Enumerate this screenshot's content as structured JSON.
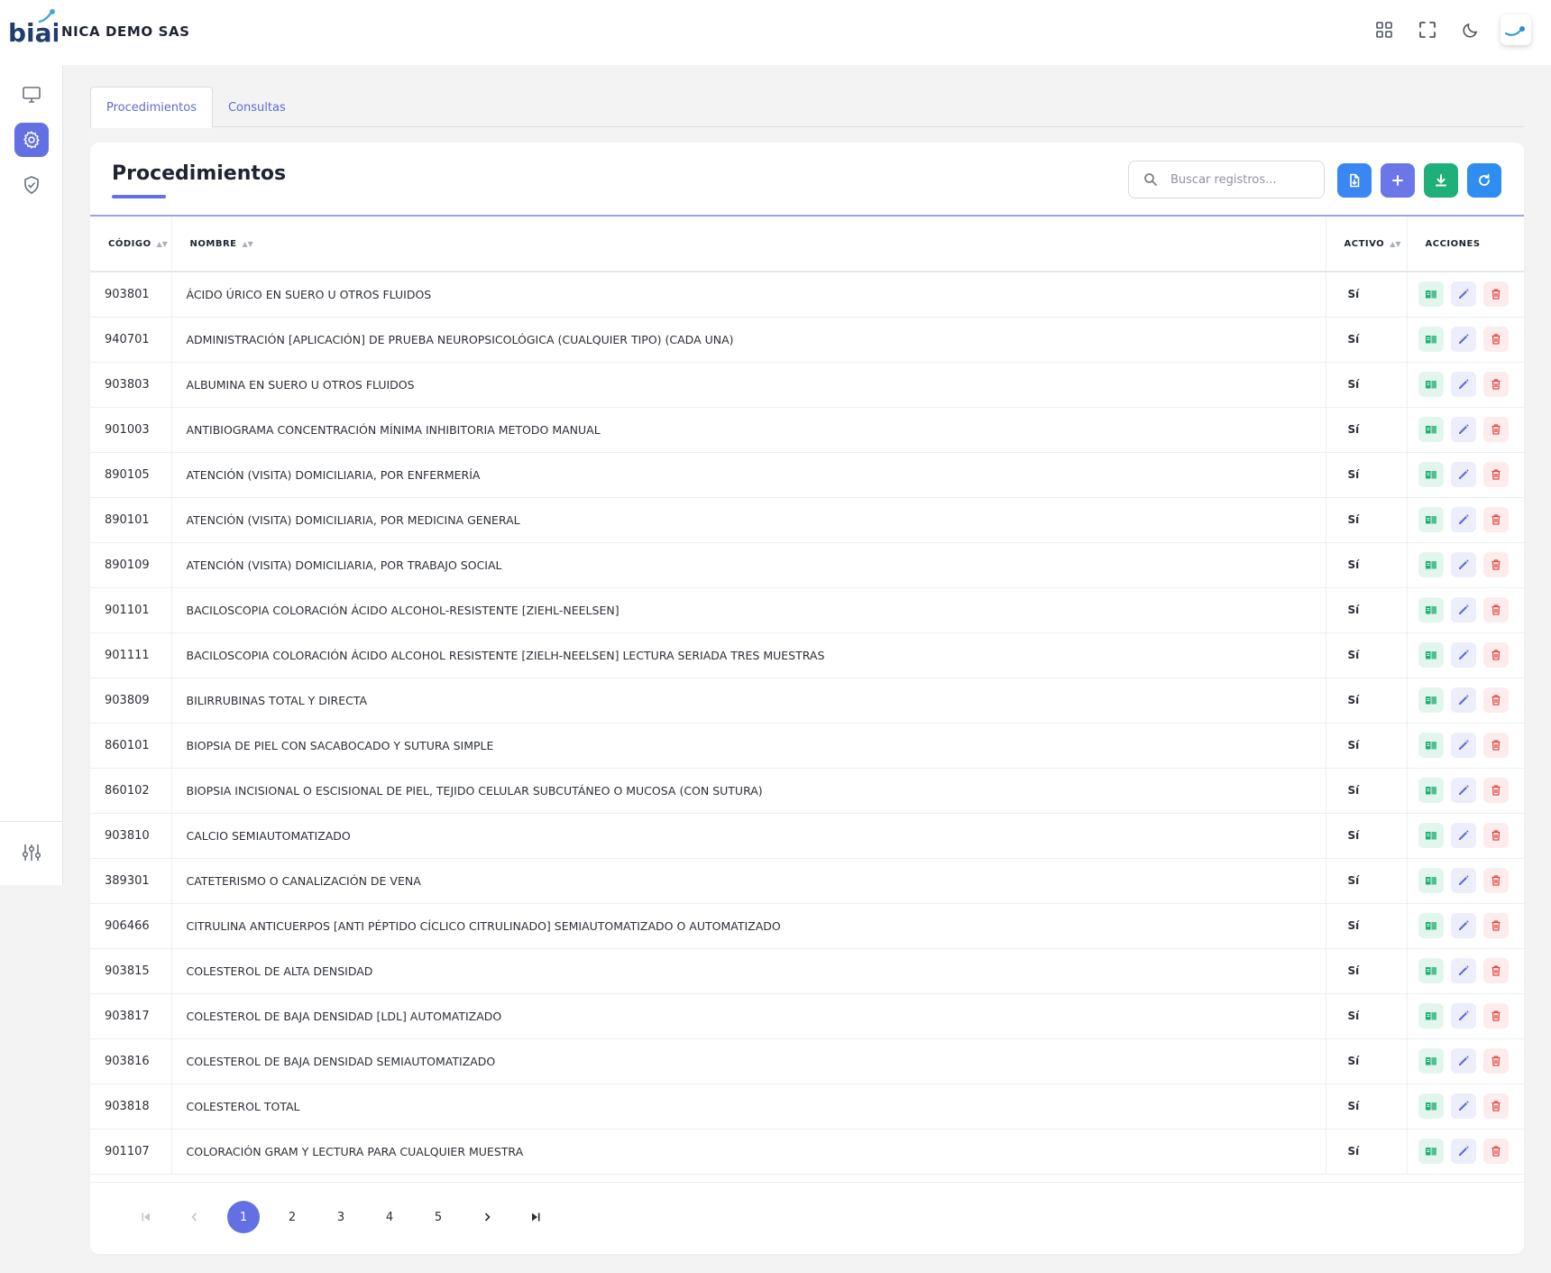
{
  "app": {
    "logo_text": "biai",
    "company": "NICA DEMO SAS"
  },
  "header": {
    "icons": [
      "apps-grid-icon",
      "fullscreen-icon",
      "moon-icon",
      "user-avatar-logo"
    ]
  },
  "sidebar": {
    "items": [
      "monitor-icon",
      "settings-gear-icon",
      "shield-check-icon"
    ],
    "bottom_item": "sliders-icon",
    "active_index": 1
  },
  "tabs": [
    {
      "label": "Procedimientos",
      "active": true
    },
    {
      "label": "Consultas",
      "active": false
    }
  ],
  "card": {
    "title": "Procedimientos",
    "search_placeholder": "Buscar registros...",
    "actions": [
      "import-file-icon",
      "add-icon",
      "download-icon",
      "refresh-icon"
    ]
  },
  "table": {
    "columns": [
      "CÓDIGO",
      "NOMBRE",
      "ACTIVO",
      "ACCIONES"
    ],
    "rows": [
      {
        "code": "903801",
        "name": "ÁCIDO ÚRICO EN SUERO U OTROS FLUIDOS",
        "active": "Sí"
      },
      {
        "code": "940701",
        "name": "ADMINISTRACIÓN [APLICACIÓN] DE PRUEBA NEUROPSICOLÓGICA (CUALQUIER TIPO) (CADA UNA)",
        "active": "Sí"
      },
      {
        "code": "903803",
        "name": "ALBUMINA EN SUERO U OTROS FLUIDOS",
        "active": "Sí"
      },
      {
        "code": "901003",
        "name": "ANTIBIOGRAMA CONCENTRACIÓN MÍNIMA INHIBITORIA METODO MANUAL",
        "active": "Sí"
      },
      {
        "code": "890105",
        "name": "ATENCIÓN (VISITA) DOMICILIARIA, POR ENFERMERÍA",
        "active": "Sí"
      },
      {
        "code": "890101",
        "name": "ATENCIÓN (VISITA) DOMICILIARIA, POR MEDICINA GENERAL",
        "active": "Sí"
      },
      {
        "code": "890109",
        "name": "ATENCIÓN (VISITA) DOMICILIARIA, POR TRABAJO SOCIAL",
        "active": "Sí"
      },
      {
        "code": "901101",
        "name": "BACILOSCOPIA COLORACIÓN ÁCIDO ALCOHOL-RESISTENTE [ZIEHL-NEELSEN]",
        "active": "Sí"
      },
      {
        "code": "901111",
        "name": "BACILOSCOPIA COLORACIÓN ÁCIDO ALCOHOL RESISTENTE [ZIELH-NEELSEN] LECTURA SERIADA TRES MUESTRAS",
        "active": "Sí"
      },
      {
        "code": "903809",
        "name": "BILIRRUBINAS TOTAL Y DIRECTA",
        "active": "Sí"
      },
      {
        "code": "860101",
        "name": "BIOPSIA DE PIEL CON SACABOCADO Y SUTURA SIMPLE",
        "active": "Sí"
      },
      {
        "code": "860102",
        "name": "BIOPSIA INCISIONAL O ESCISIONAL DE PIEL, TEJIDO CELULAR SUBCUTÁNEO O MUCOSA (CON SUTURA)",
        "active": "Sí"
      },
      {
        "code": "903810",
        "name": "CALCIO SEMIAUTOMATIZADO",
        "active": "Sí"
      },
      {
        "code": "389301",
        "name": "CATETERISMO O CANALIZACIÓN DE VENA",
        "active": "Sí"
      },
      {
        "code": "906466",
        "name": "CITRULINA ANTICUERPOS [ANTI PÉPTIDO CÍCLICO CITRULINADO] SEMIAUTOMATIZADO O AUTOMATIZADO",
        "active": "Sí"
      },
      {
        "code": "903815",
        "name": "COLESTEROL DE ALTA DENSIDAD",
        "active": "Sí"
      },
      {
        "code": "903817",
        "name": "COLESTEROL DE BAJA DENSIDAD [LDL] AUTOMATIZADO",
        "active": "Sí"
      },
      {
        "code": "903816",
        "name": "COLESTEROL DE BAJA DENSIDAD SEMIAUTOMATIZADO",
        "active": "Sí"
      },
      {
        "code": "903818",
        "name": "COLESTEROL TOTAL",
        "active": "Sí"
      },
      {
        "code": "901107",
        "name": "COLORACIÓN GRAM Y LECTURA PARA CUALQUIER MUESTRA",
        "active": "Sí"
      }
    ]
  },
  "pagination": {
    "pages": [
      "1",
      "2",
      "3",
      "4",
      "5"
    ],
    "current": "1"
  },
  "colors": {
    "primary": "#6270e4",
    "green": "#1fb07a",
    "blue": "#3a86f2",
    "red": "#e24848"
  }
}
